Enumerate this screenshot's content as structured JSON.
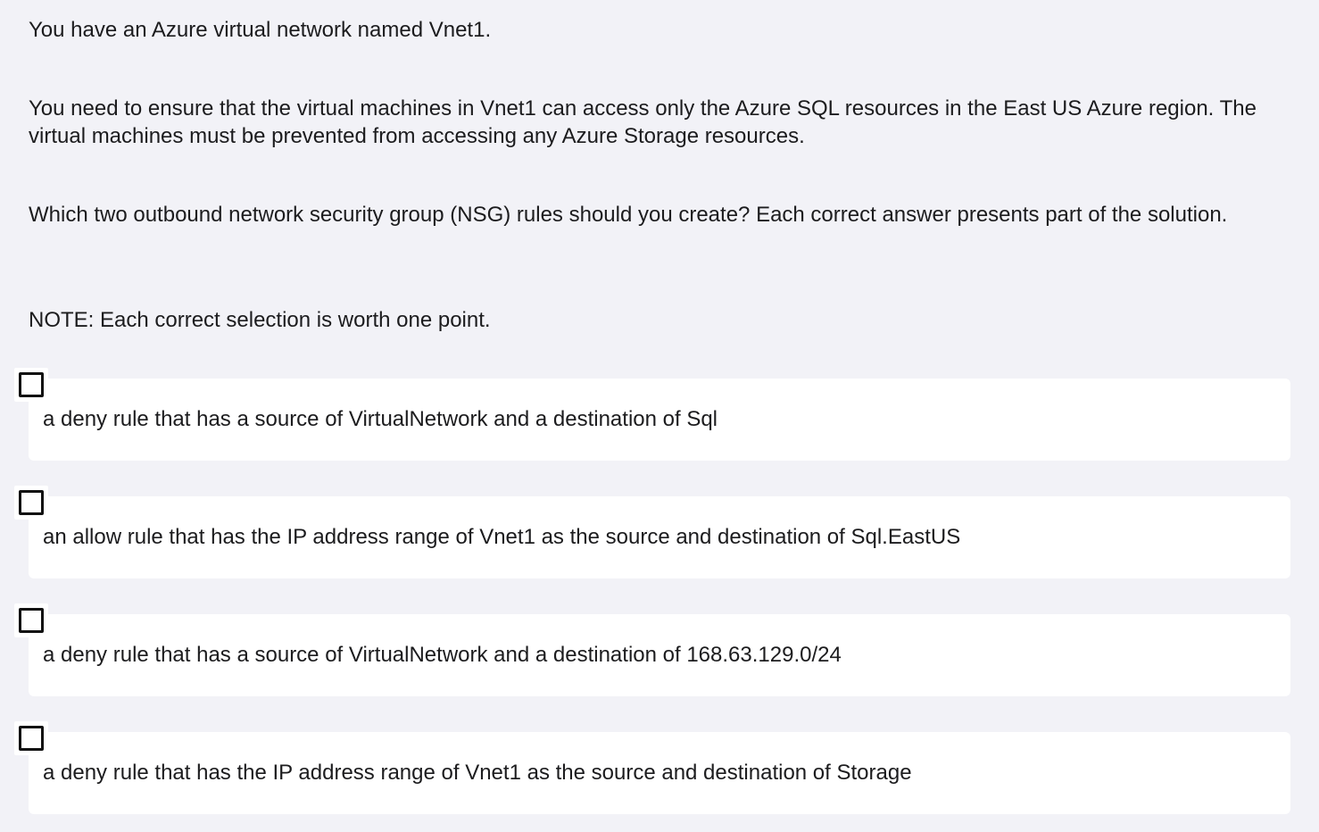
{
  "question": {
    "paragraphs": [
      "You have an Azure virtual network named Vnet1.",
      "You need to ensure that the virtual machines in Vnet1 can access only the Azure SQL resources in the East US Azure region. The virtual machines must be prevented from accessing any Azure Storage resources.",
      "Which two outbound network security group (NSG) rules should you create? Each correct answer presents part of the solution.",
      "NOTE: Each correct selection is worth one point."
    ]
  },
  "options": [
    {
      "label": "a deny rule that has a source of VirtualNetwork and a destination of Sql",
      "checked": false
    },
    {
      "label": "an allow rule that has the IP address range of Vnet1 as the source and destination of Sql.EastUS",
      "checked": false
    },
    {
      "label": "a deny rule that has a source of VirtualNetwork and a destination of 168.63.129.0/24",
      "checked": false
    },
    {
      "label": "a deny rule that has the IP address range of Vnet1 as the source and destination of Storage",
      "checked": false
    }
  ],
  "colors": {
    "background": "#f2f2f7",
    "card": "#ffffff",
    "text": "#1c1c1e",
    "checkbox_border": "#111111"
  }
}
